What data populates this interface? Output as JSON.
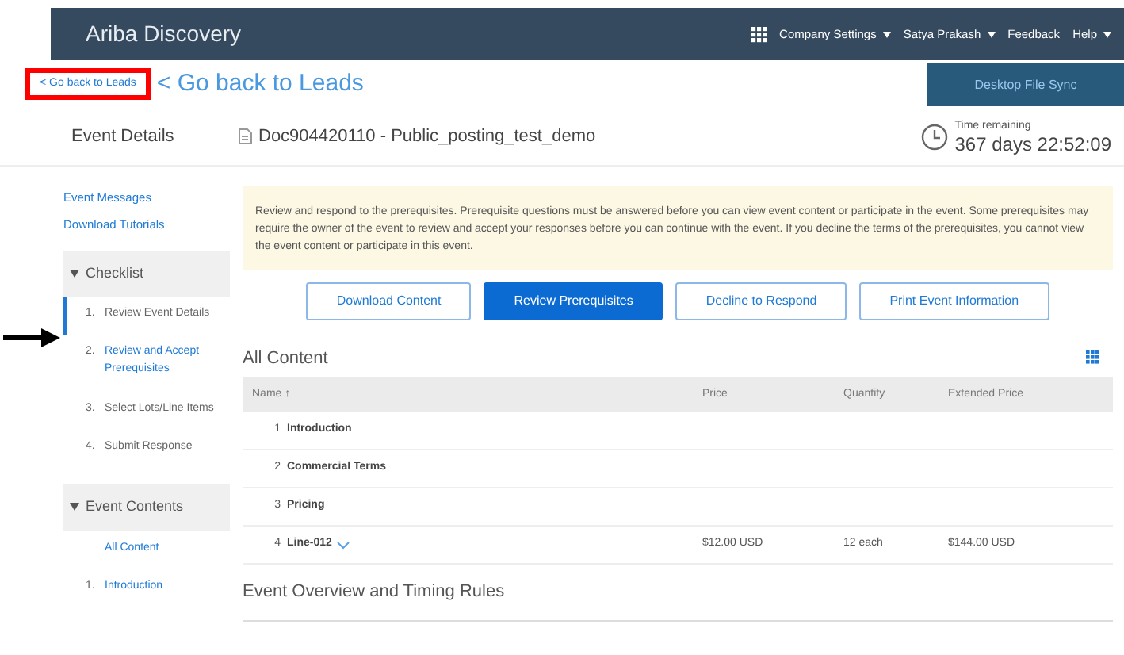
{
  "header": {
    "app_title": "Ariba Discovery",
    "menus": [
      {
        "label": "Company Settings",
        "dropdown": true
      },
      {
        "label": "Satya Prakash",
        "dropdown": true
      },
      {
        "label": "Feedback",
        "dropdown": false
      },
      {
        "label": "Help",
        "dropdown": true
      }
    ]
  },
  "back_link_small": "< Go back to Leads",
  "back_link_large": "< Go back to Leads",
  "desktop_sync_button": "Desktop File Sync",
  "sidebar": {
    "title": "Event Details",
    "links": [
      "Event Messages",
      "Download Tutorials"
    ],
    "sections": [
      {
        "title": "Checklist",
        "expanded": true,
        "items": [
          {
            "number": "1.",
            "label": "Review Event Details",
            "selected": true,
            "link": false
          },
          {
            "number": "2.",
            "label": "Review and Accept Prerequisites",
            "selected": false,
            "link": true
          },
          {
            "number": "3.",
            "label": "Select Lots/Line Items",
            "selected": false,
            "link": false
          },
          {
            "number": "4.",
            "label": "Submit Response",
            "selected": false,
            "link": false
          }
        ]
      },
      {
        "title": "Event Contents",
        "expanded": true,
        "items": [
          {
            "label": "All Content",
            "selected": false,
            "link": true
          },
          {
            "number": "1.",
            "label": "Introduction",
            "selected": false,
            "link": true
          }
        ]
      }
    ]
  },
  "document_title": "Doc904420110 - Public_posting_test_demo",
  "time_remaining": {
    "label": "Time remaining",
    "value": "367 days 22:52:09"
  },
  "notice": "Review and respond to the prerequisites. Prerequisite questions must be answered before you can view event content or participate in the event. Some prerequisites may require the owner of the event to review and accept your responses before you can continue with the event. If you decline the terms of the prerequisites, you cannot view the event content or participate in this event.",
  "buttons": [
    {
      "label": "Download Content",
      "primary": false
    },
    {
      "label": "Review Prerequisites",
      "primary": true
    },
    {
      "label": "Decline to Respond",
      "primary": false
    },
    {
      "label": "Print Event Information",
      "primary": false
    }
  ],
  "content_table": {
    "title": "All Content",
    "columns": [
      "Name ↑",
      "Price",
      "Quantity",
      "Extended Price"
    ],
    "rows": [
      {
        "number": "1",
        "name": "Introduction",
        "expandable": false
      },
      {
        "number": "2",
        "name": "Commercial Terms",
        "expandable": false
      },
      {
        "number": "3",
        "name": "Pricing",
        "expandable": false
      },
      {
        "number": "4",
        "name": "Line-012",
        "expandable": true,
        "price": "$12.00 USD",
        "quantity": "12 each",
        "extended_price": "$144.00 USD"
      }
    ]
  },
  "section_title": "Event Overview and Timing Rules"
}
